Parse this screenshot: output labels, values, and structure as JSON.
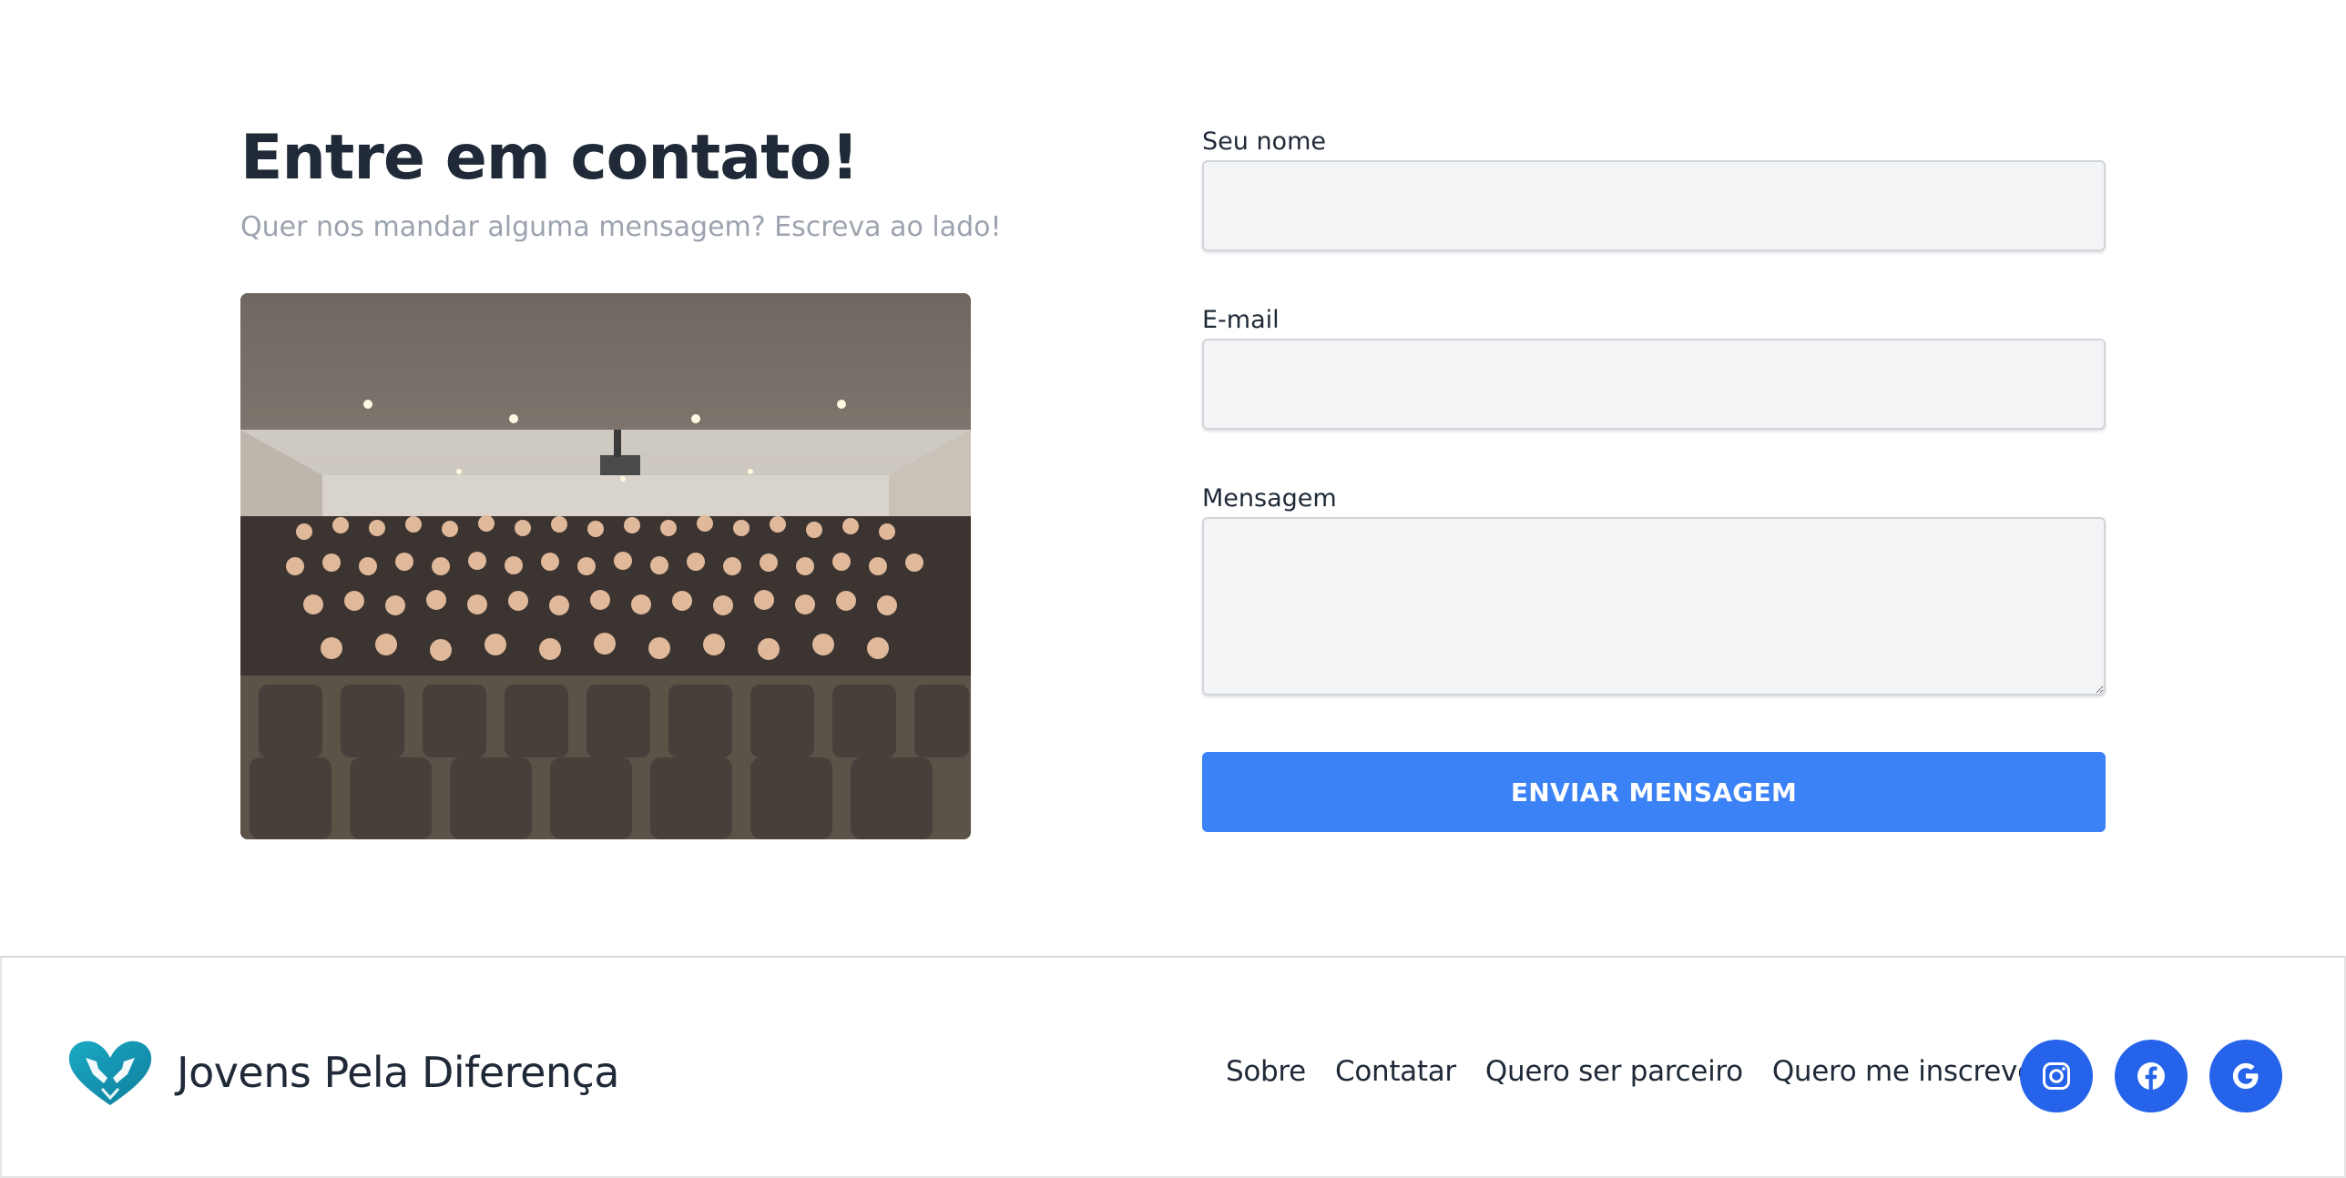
{
  "contact": {
    "title": "Entre em contato!",
    "subtitle": "Quer nos mandar alguma mensagem? Escreva ao lado!",
    "form": {
      "name_label": "Seu nome",
      "name_value": "",
      "email_label": "E-mail",
      "email_value": "",
      "message_label": "Mensagem",
      "message_value": "",
      "submit_label": "ENVIAR MENSAGEM"
    }
  },
  "footer": {
    "brand_name": "Jovens Pela Diferença",
    "logo_icon": "hands-heart-logo",
    "nav": [
      {
        "label": "Sobre"
      },
      {
        "label": "Contatar"
      },
      {
        "label": "Quero ser parceiro"
      },
      {
        "label": "Quero me inscrever"
      }
    ],
    "socials": [
      {
        "icon": "instagram-icon"
      },
      {
        "icon": "facebook-icon"
      },
      {
        "icon": "google-icon"
      }
    ]
  },
  "colors": {
    "accent": "#3b82f6",
    "social_bg": "#2563eb",
    "heading": "#1f2937",
    "muted": "#9ca3af",
    "input_bg": "#f3f4f6",
    "logo_teal": "#1aa9c4"
  }
}
